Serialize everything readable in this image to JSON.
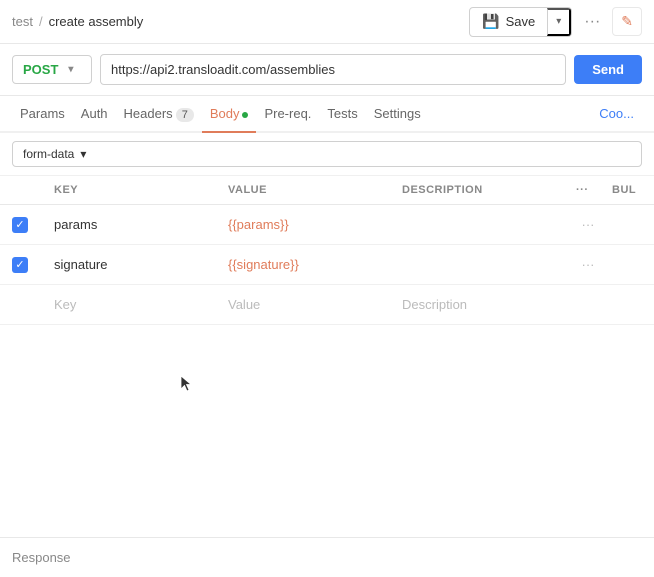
{
  "header": {
    "breadcrumb_test": "test",
    "breadcrumb_sep": "/",
    "breadcrumb_current": "create assembly",
    "save_label": "Save",
    "dots_label": "···",
    "edit_icon": "✎"
  },
  "url_bar": {
    "method": "POST",
    "url": "https://api2.transloadit.com/assemblies",
    "send_label": "Send"
  },
  "tabs": [
    {
      "id": "params",
      "label": "Params",
      "active": false,
      "badge": null,
      "dot": false
    },
    {
      "id": "auth",
      "label": "Auth",
      "active": false,
      "badge": null,
      "dot": false
    },
    {
      "id": "headers",
      "label": "Headers",
      "active": false,
      "badge": "7",
      "dot": false
    },
    {
      "id": "body",
      "label": "Body",
      "active": true,
      "badge": null,
      "dot": true
    },
    {
      "id": "prereq",
      "label": "Pre-req.",
      "active": false,
      "badge": null,
      "dot": false
    },
    {
      "id": "tests",
      "label": "Tests",
      "active": false,
      "badge": null,
      "dot": false
    },
    {
      "id": "settings",
      "label": "Settings",
      "active": false,
      "badge": null,
      "dot": false
    }
  ],
  "tab_coo": "Coo",
  "body_type": "form-data",
  "table": {
    "headers": {
      "key": "KEY",
      "value": "VALUE",
      "description": "DESCRIPTION",
      "bulk": "Bul"
    },
    "rows": [
      {
        "enabled": true,
        "key": "params",
        "value": "{{params}}",
        "description": ""
      },
      {
        "enabled": true,
        "key": "signature",
        "value": "{{signature}}",
        "description": ""
      }
    ],
    "placeholder": {
      "key": "Key",
      "value": "Value",
      "description": "Description"
    }
  },
  "response": {
    "label": "Response"
  }
}
